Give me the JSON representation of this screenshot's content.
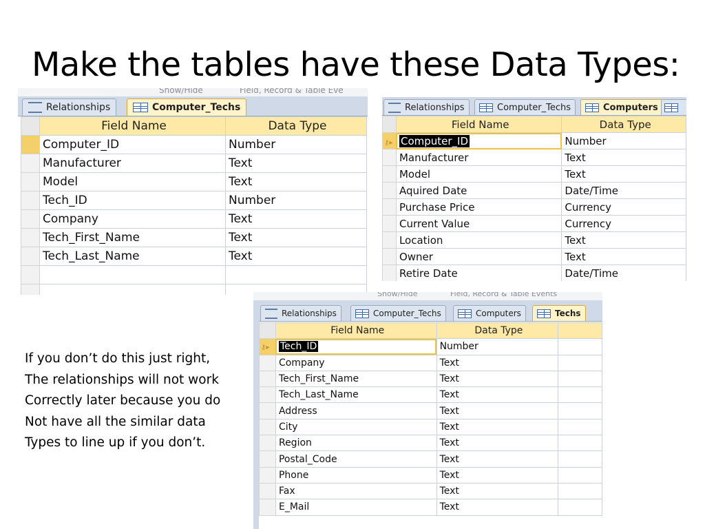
{
  "slide": {
    "title": "Make the tables have these Data Types:",
    "note_lines": [
      "If you don’t do this just right,",
      "The relationships will not work",
      "Correctly later because you do",
      "Not have all the similar data",
      "Types to line up if you don’t."
    ]
  },
  "screens": [
    {
      "ribbon": [
        "Show/Hide",
        "Field, Record & Table Eve"
      ],
      "tabs": [
        {
          "label": "Relationships",
          "icon": "relationships-icon"
        },
        {
          "label": "Computer_Techs",
          "icon": "table-icon",
          "active": true
        }
      ],
      "headers": {
        "field": "Field Name",
        "type": "Data Type"
      },
      "rows": [
        {
          "field": "Computer_ID",
          "type": "Number"
        },
        {
          "field": "Manufacturer",
          "type": "Text"
        },
        {
          "field": "Model",
          "type": "Text"
        },
        {
          "field": "Tech_ID",
          "type": "Number"
        },
        {
          "field": "Company",
          "type": "Text"
        },
        {
          "field": "Tech_First_Name",
          "type": "Text"
        },
        {
          "field": "Tech_Last_Name",
          "type": "Text"
        }
      ]
    },
    {
      "tabs": [
        {
          "label": "Relationships",
          "icon": "relationships-icon"
        },
        {
          "label": "Computer_Techs",
          "icon": "table-icon"
        },
        {
          "label": "Computers",
          "icon": "table-icon",
          "active": true
        }
      ],
      "headers": {
        "field": "Field Name",
        "type": "Data Type"
      },
      "primary_key": "Computer_ID",
      "rows": [
        {
          "field": "Computer_ID",
          "type": "Number"
        },
        {
          "field": "Manufacturer",
          "type": "Text"
        },
        {
          "field": "Model",
          "type": "Text"
        },
        {
          "field": "Aquired Date",
          "type": "Date/Time"
        },
        {
          "field": "Purchase Price",
          "type": "Currency"
        },
        {
          "field": "Current Value",
          "type": "Currency"
        },
        {
          "field": "Location",
          "type": "Text"
        },
        {
          "field": "Owner",
          "type": "Text"
        },
        {
          "field": "Retire Date",
          "type": "Date/Time"
        }
      ]
    },
    {
      "ribbon": [
        "Show/Hide",
        "Field, Record & Table Events"
      ],
      "tabs": [
        {
          "label": "Relationships",
          "icon": "relationships-icon"
        },
        {
          "label": "Computer_Techs",
          "icon": "table-icon"
        },
        {
          "label": "Computers",
          "icon": "table-icon"
        },
        {
          "label": "Techs",
          "icon": "table-icon",
          "active": true
        }
      ],
      "headers": {
        "field": "Field Name",
        "type": "Data Type"
      },
      "primary_key": "Tech_ID",
      "rows": [
        {
          "field": "Tech_ID",
          "type": "Number"
        },
        {
          "field": "Company",
          "type": "Text"
        },
        {
          "field": "Tech_First_Name",
          "type": "Text"
        },
        {
          "field": "Tech_Last_Name",
          "type": "Text"
        },
        {
          "field": "Address",
          "type": "Text"
        },
        {
          "field": "City",
          "type": "Text"
        },
        {
          "field": "Region",
          "type": "Text"
        },
        {
          "field": "Postal_Code",
          "type": "Text"
        },
        {
          "field": "Phone",
          "type": "Text"
        },
        {
          "field": "Fax",
          "type": "Text"
        },
        {
          "field": "E_Mail",
          "type": "Text"
        }
      ]
    }
  ]
}
